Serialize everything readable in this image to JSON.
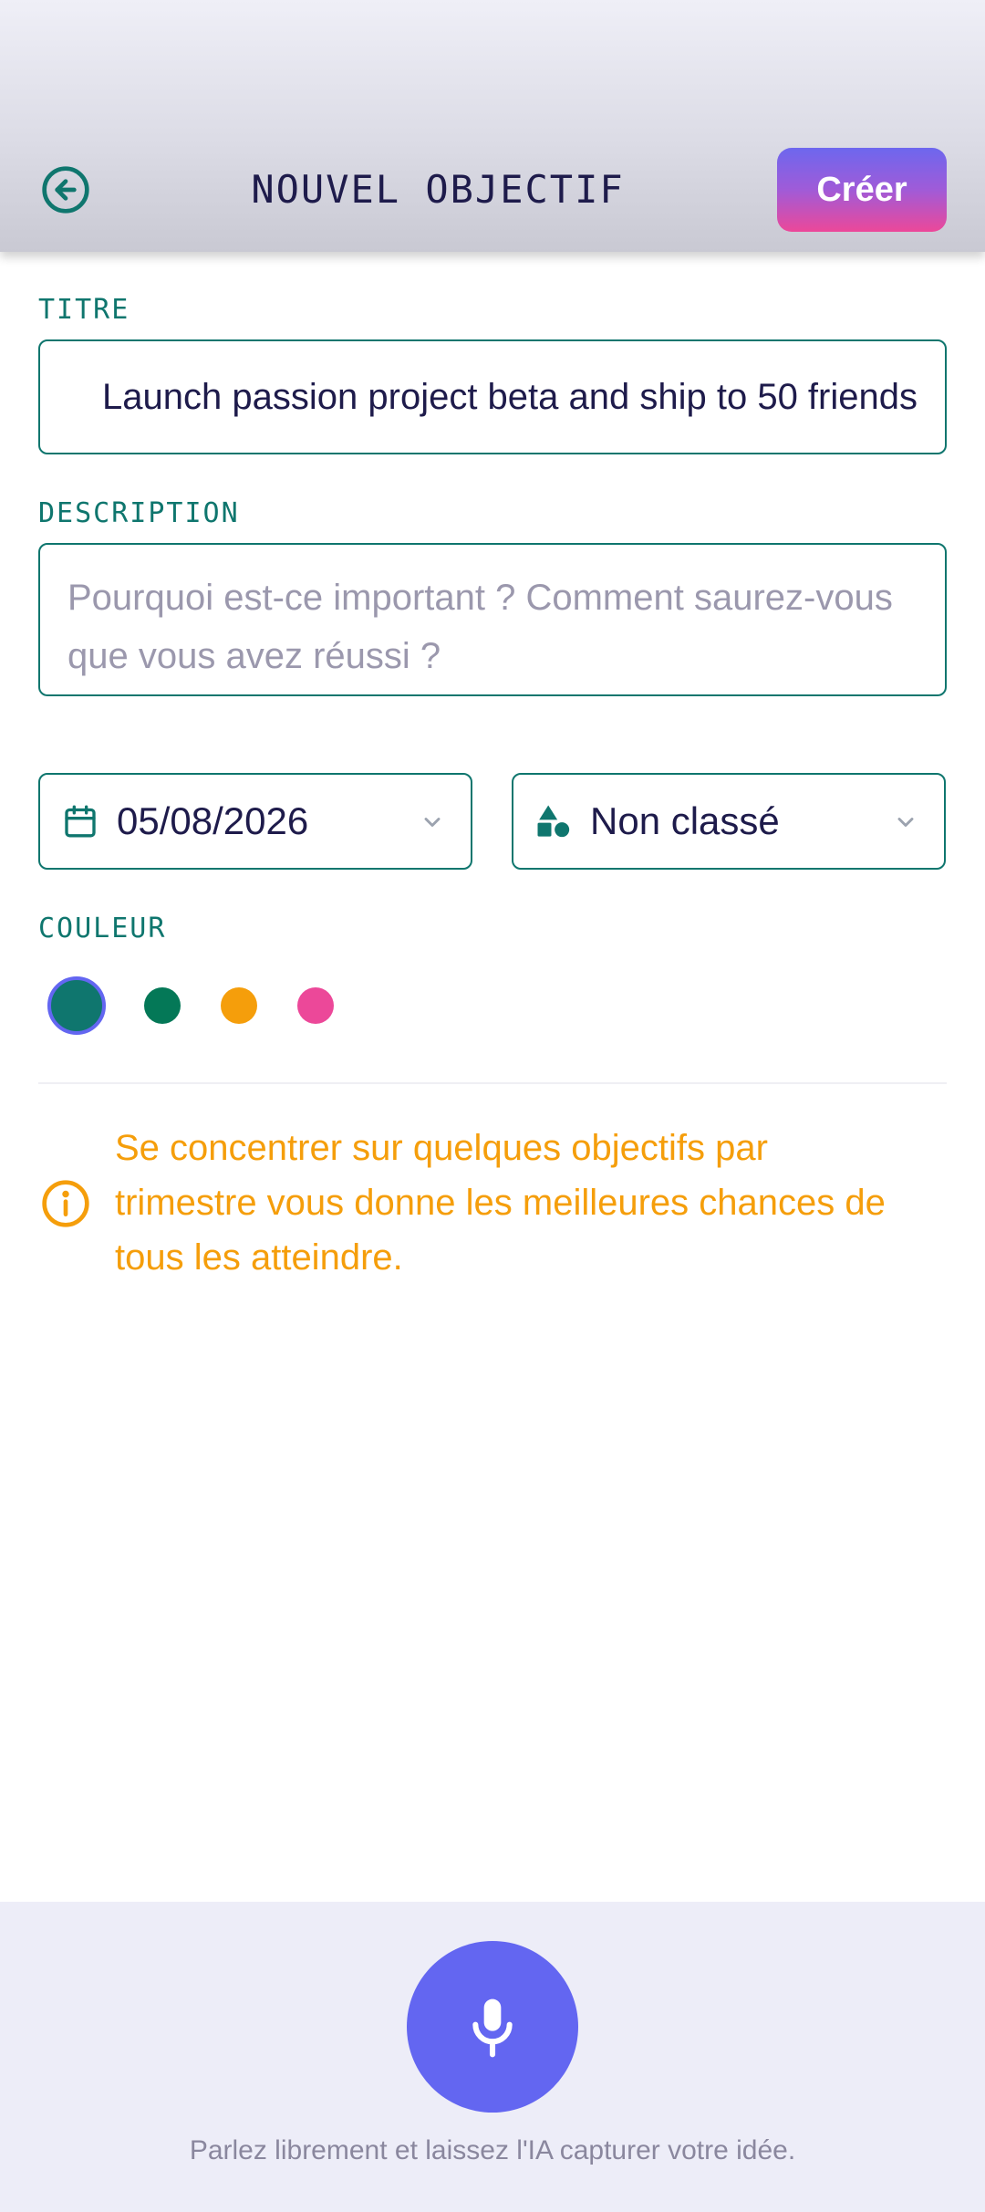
{
  "header": {
    "title": "NOUVEL OBJECTIF",
    "create_label": "Créer",
    "back_icon": "arrow-left-circle-icon"
  },
  "form": {
    "title_label": "TITRE",
    "title_value": "Launch passion project beta and ship to 50 friends",
    "description_label": "DESCRIPTION",
    "description_placeholder": "Pourquoi est-ce important ? Comment saurez-vous que vous avez réussi ?",
    "date_value": "05/08/2026",
    "date_icon": "calendar-icon",
    "category_value": "Non classé",
    "category_icon": "shapes-icon",
    "color_label": "COULEUR",
    "colors": [
      {
        "name": "teal",
        "hex": "#0f766e",
        "selected": true
      },
      {
        "name": "green",
        "hex": "#047857",
        "selected": false
      },
      {
        "name": "amber",
        "hex": "#f59e0b",
        "selected": false
      },
      {
        "name": "pink",
        "hex": "#ec4899",
        "selected": false
      }
    ]
  },
  "info": {
    "icon": "info-circle-icon",
    "text": "Se concentrer sur quelques objectifs par trimestre vous donne les meilleures chances de tous les atteindre."
  },
  "voice": {
    "icon": "microphone-icon",
    "hint": "Parlez librement et laissez l'IA capturer votre idée."
  },
  "theme": {
    "accent": "#6366f1",
    "primary": "#0f766e",
    "warning": "#f59e0b",
    "text": "#1e1b4b"
  }
}
